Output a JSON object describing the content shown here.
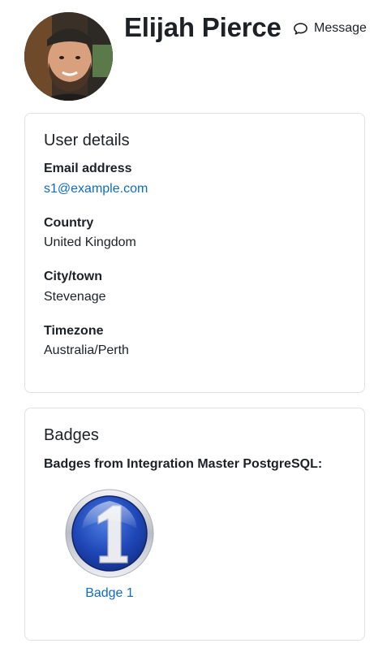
{
  "profile": {
    "name": "Elijah Pierce",
    "message_label": "Message",
    "avatar_icon": "user-avatar-photo",
    "message_icon": "chat-bubble-icon"
  },
  "user_details": {
    "title": "User details",
    "fields": [
      {
        "label": "Email address",
        "value": "s1@example.com"
      },
      {
        "label": "Country",
        "value": "United Kingdom"
      },
      {
        "label": "City/town",
        "value": "Stevenage"
      },
      {
        "label": "Timezone",
        "value": "Australia/Perth"
      }
    ]
  },
  "badges": {
    "title": "Badges",
    "subtitle": "Badges from Integration Master PostgreSQL:",
    "items": [
      {
        "label": "Badge 1",
        "number": "1",
        "icon": "badge-number-one-icon"
      }
    ]
  },
  "colors": {
    "link": "#0f6cbf",
    "text": "#1d2125",
    "border": "#dee2e6",
    "badge_blue": "#1f47b8"
  }
}
